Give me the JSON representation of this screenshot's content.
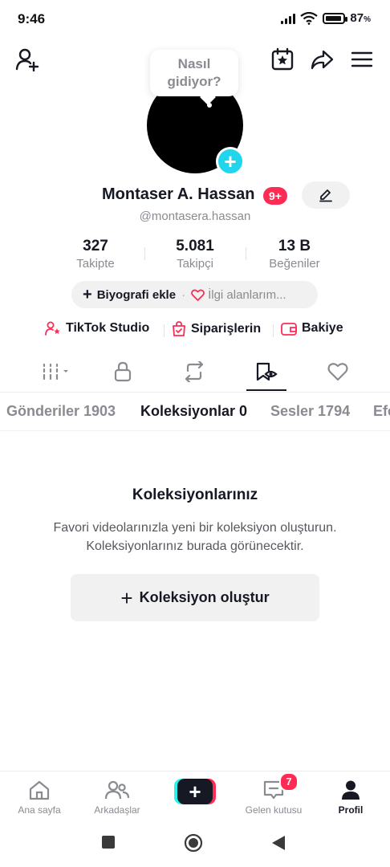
{
  "status_bar": {
    "time": "9:46",
    "battery": "87",
    "battery_unit": "%"
  },
  "tooltip": {
    "line1": "Nasıl",
    "line2": "gidiyor?"
  },
  "profile": {
    "name": "Montaser A. Hassan",
    "badge": "9+",
    "handle": "@montasera.hassan"
  },
  "stats": [
    {
      "value": "327",
      "label": "Takipte"
    },
    {
      "value": "5.081",
      "label": "Takipçi"
    },
    {
      "value": "13 B",
      "label": "Beğeniler"
    }
  ],
  "bio": {
    "add_label": "Biyografi ekle",
    "separator": "·",
    "interests_label": "İlgi alanlarım..."
  },
  "links": [
    {
      "label": "TikTok Studio",
      "icon": "person-star-icon"
    },
    {
      "label": "Siparişlerin",
      "icon": "shopping-bag-icon"
    },
    {
      "label": "Bakiye",
      "icon": "wallet-icon"
    }
  ],
  "icon_tabs": [
    "videos-grid-icon",
    "lock-icon",
    "repost-icon",
    "saved-bookmark-icon",
    "liked-heart-icon"
  ],
  "text_tabs": [
    {
      "label": "Gönderiler 1903"
    },
    {
      "label": "Koleksiyonlar 0"
    },
    {
      "label": "Sesler 1794"
    },
    {
      "label": "Efe"
    }
  ],
  "empty_state": {
    "title": "Koleksiyonlarınız",
    "desc_line1": "Favori videolarınızla yeni bir koleksiyon oluşturun.",
    "desc_line2": "Koleksiyonlarınız burada görünecektir.",
    "button": "Koleksiyon oluştur"
  },
  "bottom_nav": {
    "home": "Ana sayfa",
    "friends": "Arkadaşlar",
    "inbox": "Gelen kutusu",
    "inbox_badge": "7",
    "profile": "Profil"
  },
  "colors": {
    "accent": "#fe2c55",
    "cyan": "#20d5ec",
    "text": "#161823",
    "muted": "#8a8b91"
  }
}
